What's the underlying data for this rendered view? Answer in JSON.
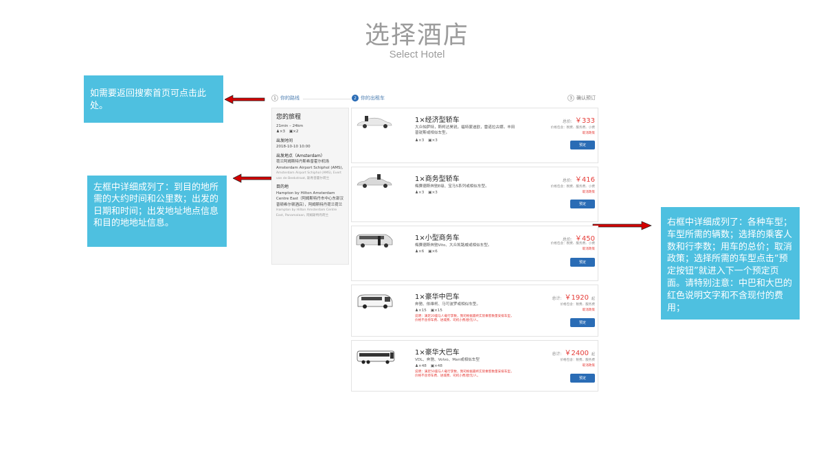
{
  "header": {
    "title": "选择酒店",
    "subtitle": "Select Hotel"
  },
  "notes": {
    "back_note": "如需要返回搜索首页可点击此处。",
    "left_note": "左框中详细成列了：到目的地所需的大约时间和公里数；出发的日期和时间；出发地址地点信息和目的地地址信息。",
    "right_note": "右框中详细成列了：各种车型；车型所需的辆数；选择的乘客人数和行李数；用车的总价；取消政策；选择所需的车型点击“预定按钮”就进入下一个预定页面。请特别注意：中巴和大巴的红色说明文字和不含现付的费用；"
  },
  "steps": [
    {
      "num": "1",
      "label": "你的路线"
    },
    {
      "num": "2",
      "label": "你的出租车"
    },
    {
      "num": "3",
      "label": "确认预订"
    }
  ],
  "trip": {
    "title": "您的旅程",
    "duration": "21min – 24km",
    "pax": "×3",
    "bags": "×2",
    "depart_time_label": "出发时间",
    "depart_time": "2018-10-10 10:00",
    "from_label": "出发地点（Amsterdam）",
    "from_name": "荷兰阿姆斯特丹斯希普霍尔机场Amsterdam Airport Schiphol (AMS),",
    "from_addr": "Amsterdam Airport Schiphol (AMS), Evert van de Beekstraat, 斯希普霍尔荷兰",
    "to_label": "目的地",
    "to_name": "Hampton by Hilton Amsterdam Centre East（阿姆斯特丹市中心东部汉普顿希尔顿酒店），阿姆斯特丹荷兰荷兰",
    "to_addr": "Hampton by Hilton Amsterdam Centre East, Panamalaan, 阿姆斯特丹荷兰"
  },
  "vehicles": [
    {
      "name": "1×经济型轿车",
      "desc": "大众帕萨特，斯柯达昊锐，福特蒙迪欧，雷诺拉古娜，丰田普锐斯或相似车型。",
      "pax": "×3",
      "bags": "×3",
      "price_label": "总价:",
      "price": "￥333",
      "unit": "",
      "includes": "价格包含：税费、服务费、小费",
      "policy": "取消政策",
      "book": "预定",
      "warning": ""
    },
    {
      "name": "1×商务型轿车",
      "desc": "梅赛德斯奔驰E级、宝马5系列或相似车型。",
      "pax": "×3",
      "bags": "×3",
      "price_label": "总价:",
      "price": "￥416",
      "unit": "",
      "includes": "价格包含：税费、服务费、小费",
      "policy": "取消政策",
      "book": "预定",
      "warning": ""
    },
    {
      "name": "1×小型商务车",
      "desc": "梅赛德斯奔驰Vito、大众凯路威或相似车型。",
      "pax": "×6",
      "bags": "×6",
      "price_label": "总价:",
      "price": "￥450",
      "unit": "",
      "includes": "价格包含：税费、服务费、小费",
      "policy": "取消政策",
      "book": "预定",
      "warning": ""
    },
    {
      "name": "1×豪华中巴车",
      "desc": "奔驰、依维柯、马可波罗或相似车型。",
      "pax": "×15",
      "bags": "×15",
      "price_label": "总计:",
      "price": "￥1920",
      "unit": "起",
      "includes": "价格包含：税费、服务费",
      "policy": "取消政策",
      "book": "预定",
      "warning": "说明：满足20座与人载行李数，我司根据最终实际乘客数量安排车型，价格不含停车费、进城费、司机小费/欧元/人。"
    },
    {
      "name": "1×豪华大巴车",
      "desc": "VDL、奔驰、Volvo、Man或相似车型",
      "pax": "×48",
      "bags": "×48",
      "price_label": "总计:",
      "price": "￥2400",
      "unit": "起",
      "includes": "价格包含：税费、服务费",
      "policy": "取消政策",
      "book": "预定",
      "warning": "说明：满足50座与人载行李数，我司根据最终实际乘客数量安排车型，价格不含停车费、进城费、司机小费/欧元/人。"
    }
  ],
  "colors": {
    "note_bg": "#4ec0e0",
    "accent": "#2a6cb5",
    "price": "#e53935",
    "arrow": "#d40000"
  }
}
